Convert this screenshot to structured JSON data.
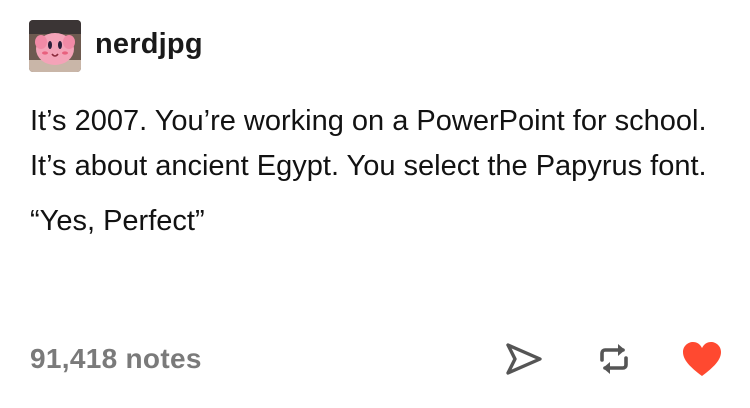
{
  "post": {
    "username": "nerdjpg",
    "avatar_icon": "kirby-avatar-icon",
    "body_paragraph": "It’s 2007. You’re working on a PowerPoint for school. It’s about ancient Egypt. You select the Papyrus font.",
    "quote": "“Yes, Perfect”",
    "notes_count": "91,418 notes"
  },
  "actions": {
    "share_icon": "share-send-icon",
    "reblog_icon": "reblog-icon",
    "like_icon": "heart-icon",
    "like_color": "#ff4930"
  },
  "colors": {
    "text": "#121212",
    "notes": "#7a7a7a",
    "icons": "#555555",
    "background": "#ffffff"
  }
}
